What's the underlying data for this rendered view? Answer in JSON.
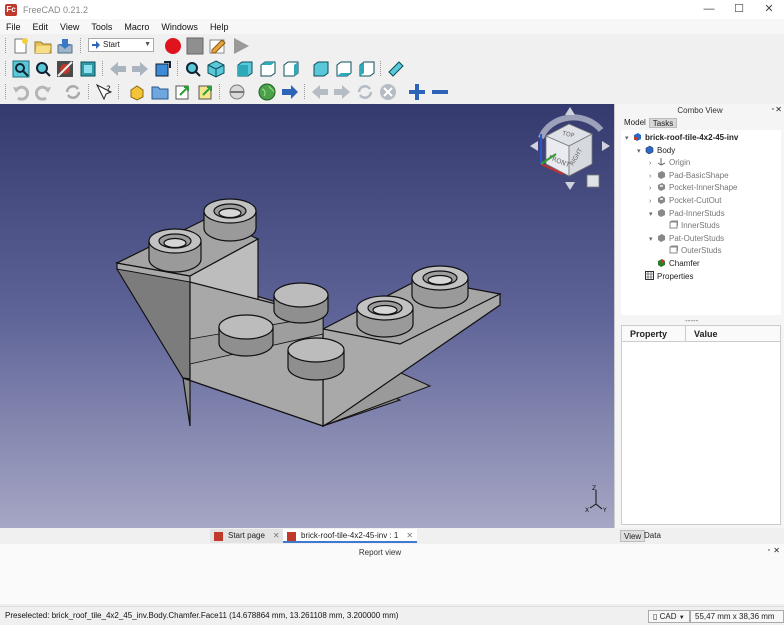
{
  "window": {
    "title": "FreeCAD 0.21.2",
    "app_icon": "Fc",
    "minimize": "—",
    "maximize": "☐",
    "close": "✕"
  },
  "menu": [
    "File",
    "Edit",
    "View",
    "Tools",
    "Macro",
    "Windows",
    "Help"
  ],
  "workbench": {
    "selected": "Start"
  },
  "combo_view": {
    "title": "Combo View",
    "tabs": [
      "Model",
      "Tasks"
    ],
    "tree": [
      {
        "label": "brick-roof-tile-4x2-45-inv",
        "icon": "document-icon",
        "color": "#2f67c7",
        "bold": true,
        "expander": "▾",
        "indent": 0
      },
      {
        "label": "Body",
        "icon": "body-icon",
        "color": "#2f67c7",
        "bold": false,
        "expander": "▾",
        "indent": 1
      },
      {
        "label": "Origin",
        "icon": "origin-icon",
        "color": "#666666",
        "bold": false,
        "expander": "›",
        "indent": 2,
        "muted": true
      },
      {
        "label": "Pad-BasicShape",
        "icon": "pad-icon",
        "color": "#888888",
        "bold": false,
        "expander": "›",
        "indent": 2,
        "muted": true
      },
      {
        "label": "Pocket-InnerShape",
        "icon": "pocket-icon",
        "color": "#888888",
        "bold": false,
        "expander": "›",
        "indent": 2,
        "muted": true
      },
      {
        "label": "Pocket-CutOut",
        "icon": "pocket-icon",
        "color": "#888888",
        "bold": false,
        "expander": "›",
        "indent": 2,
        "muted": true
      },
      {
        "label": "Pad-InnerStuds",
        "icon": "pad-icon",
        "color": "#888888",
        "bold": false,
        "expander": "▾",
        "indent": 2,
        "muted": true
      },
      {
        "label": "InnerStuds",
        "icon": "sketch-icon",
        "color": "#888888",
        "bold": false,
        "expander": "",
        "indent": 3,
        "muted": true
      },
      {
        "label": "Pat-OuterStuds",
        "icon": "pad-icon",
        "color": "#888888",
        "bold": false,
        "expander": "▾",
        "indent": 2,
        "muted": true
      },
      {
        "label": "OuterStuds",
        "icon": "sketch-icon",
        "color": "#888888",
        "bold": false,
        "expander": "",
        "indent": 3,
        "muted": true
      },
      {
        "label": "Chamfer",
        "icon": "chamfer-icon",
        "color": "#c0392b",
        "bold": false,
        "expander": "",
        "indent": 2,
        "muted": false
      },
      {
        "label": "Properties",
        "icon": "properties-icon",
        "color": "#333333",
        "bold": false,
        "expander": "",
        "indent": 1,
        "muted": false
      }
    ],
    "splitter": "-----",
    "property_headers": {
      "property": "Property",
      "value": "Value"
    }
  },
  "navcube": {
    "top": "TOP",
    "front": "FRONT",
    "right": "RIGHT"
  },
  "axis": {
    "x": "X",
    "y": "Y",
    "z": "Z"
  },
  "doc_tabs": [
    {
      "label": "Start page",
      "close": "✕"
    },
    {
      "label": "brick-roof-tile-4x2-45-inv : 1",
      "close": "✕"
    }
  ],
  "side_tabs": [
    "View",
    "Data"
  ],
  "report_view": {
    "title": "Report view"
  },
  "status": {
    "text": "Preselected: brick_roof_tile_4x2_45_inv.Body.Chamfer.Face11 (14.678864 mm, 13.261108 mm, 3.200000 mm)",
    "nav_style": "CAD",
    "dimensions": "55,47 mm x 38,36 mm"
  }
}
